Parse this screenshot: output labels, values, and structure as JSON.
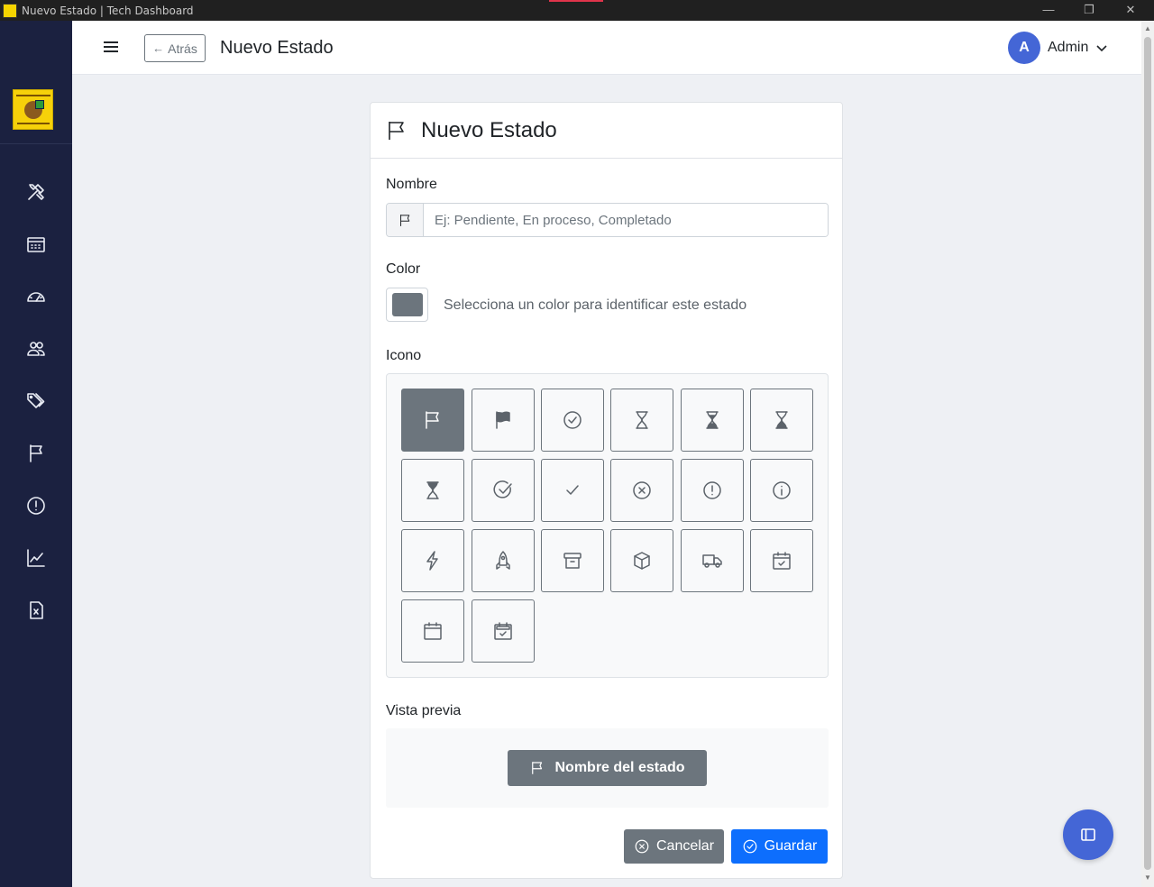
{
  "window": {
    "title": "Nuevo Estado | Tech Dashboard",
    "controls": {
      "minimize": "—",
      "restore": "❐",
      "close": "✕"
    }
  },
  "sidebar": {
    "logo_icon": "company-logo",
    "items": [
      {
        "icon": "tools-icon"
      },
      {
        "icon": "calendar-icon"
      },
      {
        "icon": "speedometer-icon"
      },
      {
        "icon": "users-icon"
      },
      {
        "icon": "tags-icon"
      },
      {
        "icon": "flag-icon"
      },
      {
        "icon": "alert-circle-icon"
      },
      {
        "icon": "chart-line-icon"
      },
      {
        "icon": "excel-file-icon"
      }
    ]
  },
  "header": {
    "back_label": "Atrás",
    "page_title": "Nuevo Estado",
    "user": {
      "initial": "A",
      "name": "Admin"
    }
  },
  "form": {
    "card_title": "Nuevo Estado",
    "name_label": "Nombre",
    "name_placeholder": "Ej: Pendiente, En proceso, Completado",
    "name_value": "",
    "color_label": "Color",
    "color_value": "#6c757d",
    "color_help": "Selecciona un color para identificar este estado",
    "icon_label": "Icono",
    "icons": [
      "flag-icon",
      "flag-fill-icon",
      "check-circle-icon",
      "hourglass-icon",
      "hourglass-split-icon",
      "hourglass-top-icon",
      "hourglass-bottom-icon",
      "check2-circle-icon",
      "check-icon",
      "x-circle-icon",
      "exclamation-circle-icon",
      "info-circle-icon",
      "lightning-icon",
      "rocket-icon",
      "archive-icon",
      "box-icon",
      "truck-icon",
      "calendar-check-icon",
      "calendar-icon",
      "calendar2-check-icon"
    ],
    "selected_icon": "flag-icon",
    "preview_label": "Vista previa",
    "preview_text": "Nombre del estado",
    "cancel_label": "Cancelar",
    "save_label": "Guardar"
  },
  "fab": {
    "icon": "layout-sidebar-icon"
  },
  "colors": {
    "sidebar_bg": "#1b2140",
    "accent": "#4466d6",
    "primary": "#0d6efd",
    "secondary": "#6c757d"
  }
}
